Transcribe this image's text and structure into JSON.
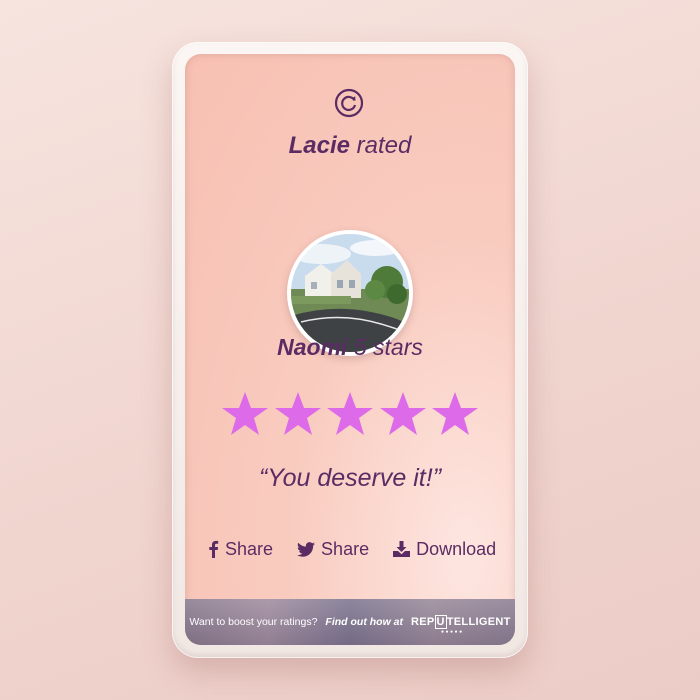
{
  "card": {
    "rater_name": "Lacie",
    "rater_suffix": " rated",
    "subject_name": "Naomi",
    "subject_suffix": " 5 stars",
    "rating": 5,
    "max_rating": 5,
    "quote": "“You deserve it!”"
  },
  "actions": [
    {
      "label": "Share",
      "icon": "facebook-icon"
    },
    {
      "label": "Share",
      "icon": "twitter-icon"
    },
    {
      "label": "Download",
      "icon": "download-icon"
    }
  ],
  "footer": {
    "prompt": "Want to boost your ratings?",
    "cta": "Find out how at",
    "brand_pre": "REP",
    "brand_u": "U",
    "brand_post": "TELLIGENT",
    "brand_dots": "●●●●●"
  },
  "colors": {
    "text": "#5b2c63",
    "star": "#dd6ae8",
    "card_bg": "#f9cbbf"
  }
}
